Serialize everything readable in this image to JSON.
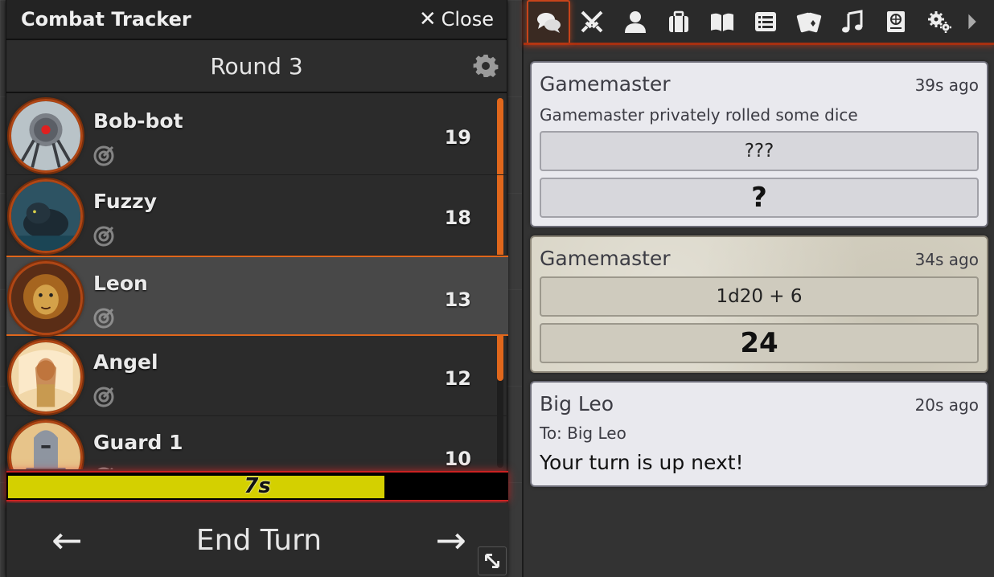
{
  "combat_tracker": {
    "title": "Combat Tracker",
    "close_label": "Close",
    "round_label": "Round 3",
    "combatants": [
      {
        "name": "Bob-bot",
        "initiative": "19",
        "active": false
      },
      {
        "name": "Fuzzy",
        "initiative": "18",
        "active": false
      },
      {
        "name": "Leon",
        "initiative": "13",
        "active": true
      },
      {
        "name": "Angel",
        "initiative": "12",
        "active": false
      },
      {
        "name": "Guard 1",
        "initiative": "10",
        "active": false
      }
    ],
    "timer": {
      "label": "7s",
      "fraction": 0.755
    },
    "end_turn_label": "End Turn",
    "prev_arrow": "←",
    "next_arrow": "→",
    "colors": {
      "accent": "#e0671c",
      "timer_fill": "#d4d000",
      "timer_glow": "#cc2222"
    }
  },
  "sidebar": {
    "tabs": [
      {
        "icon": "comments-icon",
        "active": true
      },
      {
        "icon": "crossed-swords-icon",
        "active": false
      },
      {
        "icon": "user-icon",
        "active": false
      },
      {
        "icon": "suitcase-icon",
        "active": false
      },
      {
        "icon": "book-open-icon",
        "active": false
      },
      {
        "icon": "list-icon",
        "active": false
      },
      {
        "icon": "cards-icon",
        "active": false
      },
      {
        "icon": "music-icon",
        "active": false
      },
      {
        "icon": "atlas-icon",
        "active": false
      },
      {
        "icon": "cogs-icon",
        "active": false
      },
      {
        "icon": "chevron-right-icon",
        "active": false
      }
    ],
    "messages": [
      {
        "sender": "Gamemaster",
        "time": "39s ago",
        "flavor": "Gamemaster privately rolled some dice",
        "formula": "???",
        "total": "?"
      },
      {
        "sender": "Gamemaster",
        "time": "34s ago",
        "formula": "1d20 + 6",
        "total": "24"
      },
      {
        "sender": "Big Leo",
        "time": "20s ago",
        "whisper_to": "To: Big Leo",
        "content": "Your turn is up next!"
      }
    ]
  }
}
